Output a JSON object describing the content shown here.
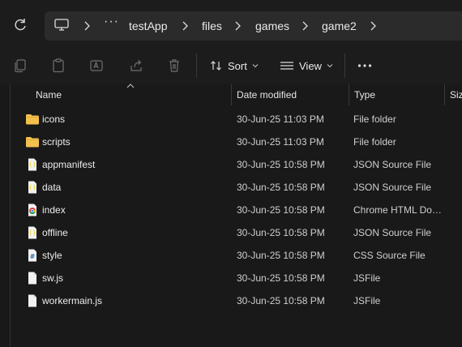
{
  "address_bar": {
    "crumbs": [
      "testApp",
      "files",
      "games",
      "game2"
    ]
  },
  "toolbar": {
    "sort_label": "Sort",
    "view_label": "View"
  },
  "columns": {
    "name": "Name",
    "date": "Date modified",
    "type": "Type",
    "size": "Size"
  },
  "files": [
    {
      "name": "icons",
      "date": "30-Jun-25 11:03 PM",
      "type": "File folder",
      "icon": "folder-icon"
    },
    {
      "name": "scripts",
      "date": "30-Jun-25 11:03 PM",
      "type": "File folder",
      "icon": "folder-icon"
    },
    {
      "name": "appmanifest",
      "date": "30-Jun-25 10:58 PM",
      "type": "JSON Source File",
      "icon": "json-file-icon"
    },
    {
      "name": "data",
      "date": "30-Jun-25 10:58 PM",
      "type": "JSON Source File",
      "icon": "json-file-icon"
    },
    {
      "name": "index",
      "date": "30-Jun-25 10:58 PM",
      "type": "Chrome HTML Do…",
      "icon": "chrome-html-icon"
    },
    {
      "name": "offline",
      "date": "30-Jun-25 10:58 PM",
      "type": "JSON Source File",
      "icon": "json-file-icon"
    },
    {
      "name": "style",
      "date": "30-Jun-25 10:58 PM",
      "type": "CSS Source File",
      "icon": "css-file-icon"
    },
    {
      "name": "sw.js",
      "date": "30-Jun-25 10:58 PM",
      "type": "JSFile",
      "icon": "blank-file-icon"
    },
    {
      "name": "workermain.js",
      "date": "30-Jun-25 10:58 PM",
      "type": "JSFile",
      "icon": "blank-file-icon"
    }
  ],
  "colors": {
    "folder": "#f4c04d",
    "json": "#e8d54a",
    "accent": "#4a9ce8"
  }
}
